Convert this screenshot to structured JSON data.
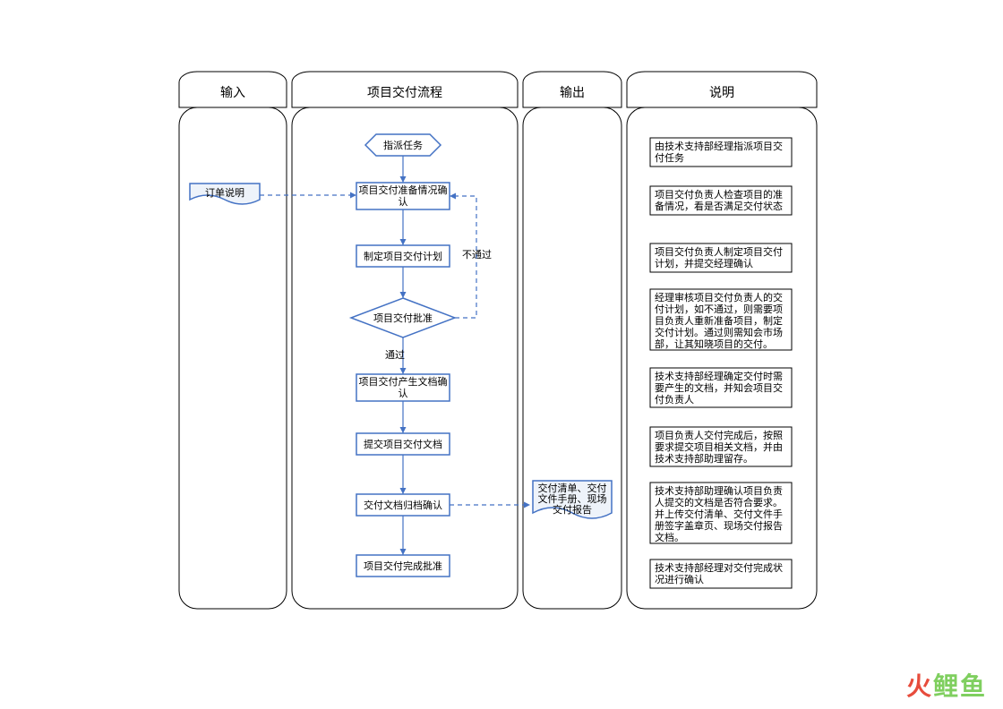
{
  "lanes": {
    "input": "输入",
    "flow": "项目交付流程",
    "output": "输出",
    "desc": "说明"
  },
  "input_doc": "订单说明",
  "flow_nodes": {
    "assign": "指派任务",
    "prep_confirm_l1": "项目交付准备情况确",
    "prep_confirm_l2": "认",
    "plan": "制定项目交付计划",
    "approve": "项目交付批准",
    "approve_pass": "通过",
    "approve_fail": "不通过",
    "doc_confirm_l1": "项目交付产生文档确",
    "doc_confirm_l2": "认",
    "doc_submit": "提交项目交付文档",
    "archive_confirm": "交付文档归档确认",
    "complete_approve": "项目交付完成批准"
  },
  "output_doc_l1": "交付清单、交付",
  "output_doc_l2": "文件手册、现场",
  "output_doc_l3": "交付报告",
  "desc_boxes": {
    "d1_l1": "由技术支持部经理指派项目交",
    "d1_l2": "付任务",
    "d2_l1": "项目交付负责人检查项目的准",
    "d2_l2": "备情况，看是否满足交付状态",
    "d3_l1": "项目交付负责人制定项目交付",
    "d3_l2": "计划，并提交经理确认",
    "d4_l1": "经理审核项目交付负责人的交",
    "d4_l2": "付计划，如不通过，则需要项",
    "d4_l3": "目负责人重新准备项目，制定",
    "d4_l4": "交付计划。通过则需知会市场",
    "d4_l5": "部，让其知晓项目的交付。",
    "d5_l1": "技术支持部经理确定交付时需",
    "d5_l2": "要产生的文档，并知会项目交",
    "d5_l3": "付负责人",
    "d6_l1": "项目负责人交付完成后，按照",
    "d6_l2": "要求提交项目相关文档，并由",
    "d6_l3": "技术支持部助理留存。",
    "d7_l1": "技术支持部助理确认项目负责",
    "d7_l2": "人提交的文档是否符合要求。",
    "d7_l3": "并上传交付清单、交付文件手",
    "d7_l4": "册签字盖章页、现场交付报告",
    "d7_l5": "文档。",
    "d8_l1": "技术支持部经理对交付完成状",
    "d8_l2": "况进行确认"
  },
  "watermark": {
    "a": "火",
    "b": "鲤",
    "c": "鱼"
  }
}
